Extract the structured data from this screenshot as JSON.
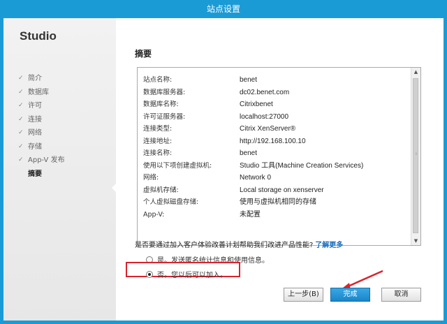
{
  "window": {
    "title": "站点设置"
  },
  "sidebar": {
    "product": "Studio",
    "steps": [
      {
        "label": "简介",
        "check": "✓"
      },
      {
        "label": "数据库",
        "check": "✓"
      },
      {
        "label": "许可",
        "check": "✓"
      },
      {
        "label": "连接",
        "check": "✓"
      },
      {
        "label": "网络",
        "check": "✓"
      },
      {
        "label": "存储",
        "check": "✓"
      },
      {
        "label": "App-V 发布",
        "check": "✓"
      },
      {
        "label": "摘要",
        "check": ""
      }
    ]
  },
  "main": {
    "heading": "摘要",
    "summary": [
      {
        "key": "站点名称:",
        "value": "benet"
      },
      {
        "key": "数据库服务器:",
        "value": "dc02.benet.com"
      },
      {
        "key": "数据库名称:",
        "value": "Citrixbenet"
      },
      {
        "key": "许可证服务器:",
        "value": "localhost:27000"
      },
      {
        "key": "连接类型:",
        "value": "Citrix XenServer®"
      },
      {
        "key": "连接地址:",
        "value": "http://192.168.100.10"
      },
      {
        "key": "连接名称:",
        "value": "benet"
      },
      {
        "key": "使用以下项创建虚拟机:",
        "value": "Studio 工具(Machine Creation Services)"
      },
      {
        "key": "网络:",
        "value": "Network 0"
      },
      {
        "key": "虚拟机存储:",
        "value": "Local storage on xenserver"
      },
      {
        "key": "个人虚拟磁盘存储:",
        "value": "使用与虚拟机相同的存储"
      },
      {
        "key": "App-V:",
        "value": "未配置"
      }
    ],
    "scroll": {
      "up": "▲",
      "down": "▼",
      "grip": "⁞"
    },
    "ceip": {
      "question": "是否要通过加入客户体验改善计划帮助我们改进产品性能?",
      "learn_more": "了解更多",
      "options": [
        {
          "label": "是。发送匿名统计信息和使用信息。",
          "selected": false
        },
        {
          "label": "否。您以后可以加入。",
          "selected": true
        }
      ]
    },
    "buttons": {
      "back": "上一步(B)",
      "finish": "完成",
      "cancel": "取消"
    }
  },
  "colors": {
    "titlebar": "#1b9bd6",
    "highlight": "#d9232d",
    "primary_button": "#1a85c9",
    "link": "#1a6fc0"
  }
}
